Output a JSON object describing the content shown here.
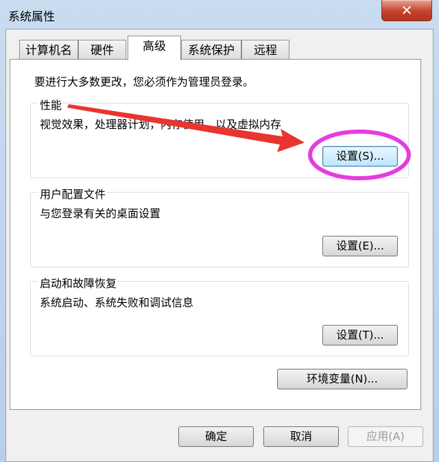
{
  "window": {
    "title": "系统属性",
    "close_symbol": "✕"
  },
  "tabs": [
    {
      "label": "计算机名"
    },
    {
      "label": "硬件"
    },
    {
      "label": "高级",
      "active": true
    },
    {
      "label": "系统保护"
    },
    {
      "label": "远程"
    }
  ],
  "intro": "要进行大多数更改，您必须作为管理员登录。",
  "performance": {
    "title": "性能",
    "description": "视觉效果，处理器计划，内存使用，以及虚拟内存",
    "button": "设置(S)..."
  },
  "user_profiles": {
    "title": "用户配置文件",
    "description": "与您登录有关的桌面设置",
    "button": "设置(E)..."
  },
  "startup_recovery": {
    "title": "启动和故障恢复",
    "description": "系统启动、系统失败和调试信息",
    "button": "设置(T)..."
  },
  "env_button": "环境变量(N)...",
  "footer": {
    "ok": "确定",
    "cancel": "取消",
    "apply": "应用(A)"
  },
  "annotation_colors": {
    "arrow": "#e8352f",
    "ellipse": "#e63ce0"
  }
}
